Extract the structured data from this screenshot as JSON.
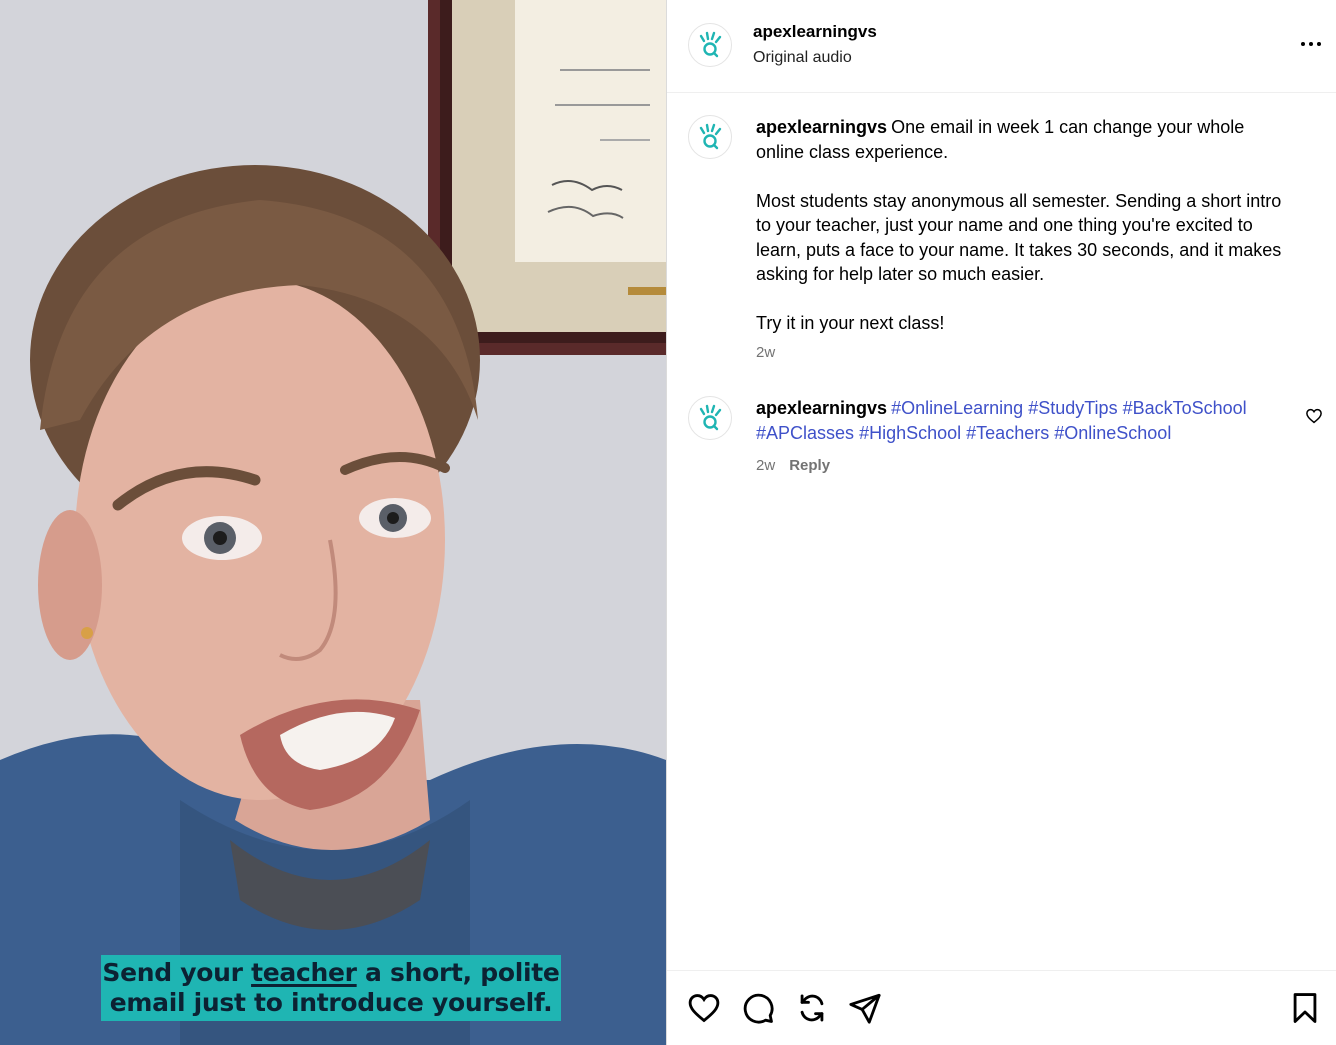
{
  "media": {
    "caption_before": "Send your ",
    "caption_underlined": "teacher",
    "caption_after": " a short, polite email just to introduce yourself."
  },
  "header": {
    "username": "apexlearningvs",
    "audio": "Original audio",
    "avatar_icon": "apex-learning-logo-icon",
    "more_icon": "more-options-icon"
  },
  "caption_post": {
    "username": "apexlearningvs",
    "text": "One email in week 1 can change your whole online class experience.\n\nMost students stay anonymous all semester. Sending a short intro to your teacher, just your name and one thing you're excited to learn, puts a face to your name. It takes 30 seconds, and it makes asking for help later so much easier.\n\nTry it in your next class!",
    "time": "2w"
  },
  "hashtag_comment": {
    "username": "apexlearningvs",
    "hashtags": [
      "#OnlineLearning",
      "#StudyTips",
      "#BackToSchool",
      "#APClasses",
      "#HighSchool",
      "#Teachers",
      "#OnlineSchool"
    ],
    "time": "2w",
    "reply_label": "Reply",
    "like_icon": "heart-outline-icon"
  },
  "action_bar": {
    "icons": [
      "heart-icon",
      "comment-icon",
      "repost-icon",
      "share-icon",
      "save-bookmark-icon"
    ]
  },
  "colors": {
    "brand_teal": "#1fb5b3",
    "hashtag_blue": "#3f51c9",
    "muted_text": "#737373"
  }
}
